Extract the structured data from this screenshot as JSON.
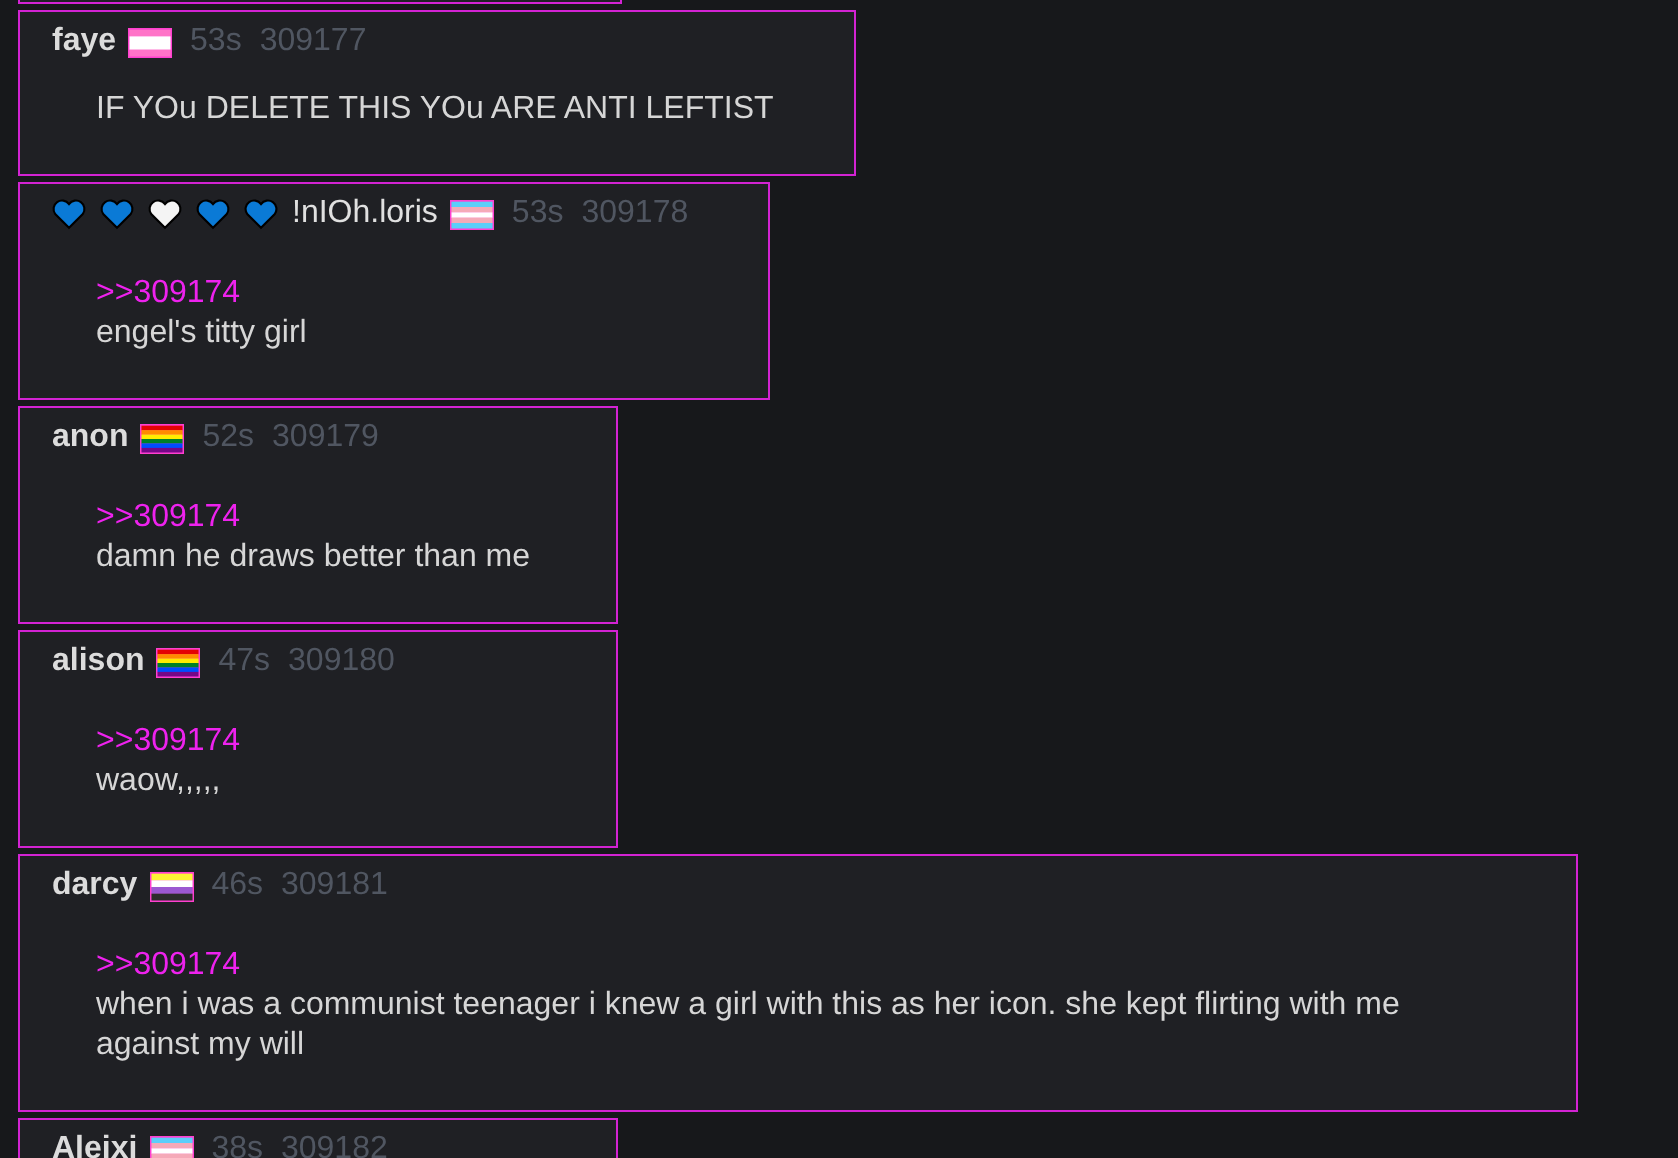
{
  "posts": [
    {
      "name": "faye",
      "kind": "pink",
      "time": "53s",
      "number": "309177",
      "lines": [
        {
          "kind": "text",
          "text": "IF YOu DELETE THIS YOu ARE ANTI LEFTIST"
        }
      ]
    },
    {
      "name": "!nIOh.loris",
      "hearts": [
        {
          "color": "#0a7ad6"
        },
        {
          "color": "#0a7ad6"
        },
        {
          "color": "#f4f4f4"
        },
        {
          "color": "#0a7ad6"
        },
        {
          "color": "#0a7ad6"
        }
      ],
      "kind": "trans",
      "time": "53s",
      "number": "309178",
      "lines": [
        {
          "kind": "quote",
          "text": ">>309174"
        },
        {
          "kind": "text",
          "text": "engel's titty girl"
        }
      ]
    },
    {
      "name": "anon",
      "kind": "rainbow",
      "time": "52s",
      "number": "309179",
      "lines": [
        {
          "kind": "quote",
          "text": ">>309174"
        },
        {
          "kind": "text",
          "text": "damn he draws better than me"
        }
      ]
    },
    {
      "name": "alison",
      "kind": "rainbow",
      "time": "47s",
      "number": "309180",
      "lines": [
        {
          "kind": "quote",
          "text": ">>309174"
        },
        {
          "kind": "text",
          "text": "waow,,,,,"
        }
      ]
    },
    {
      "name": "darcy",
      "kind": "nonbinary",
      "time": "46s",
      "number": "309181",
      "lines": [
        {
          "kind": "quote",
          "text": ">>309174"
        },
        {
          "kind": "text",
          "text": "when i was a communist teenager i knew a girl with this as her icon. she kept flirting with me against my will"
        }
      ]
    },
    {
      "name": "Aleixi",
      "kind": "trans",
      "time": "38s",
      "number": "309182"
    }
  ]
}
